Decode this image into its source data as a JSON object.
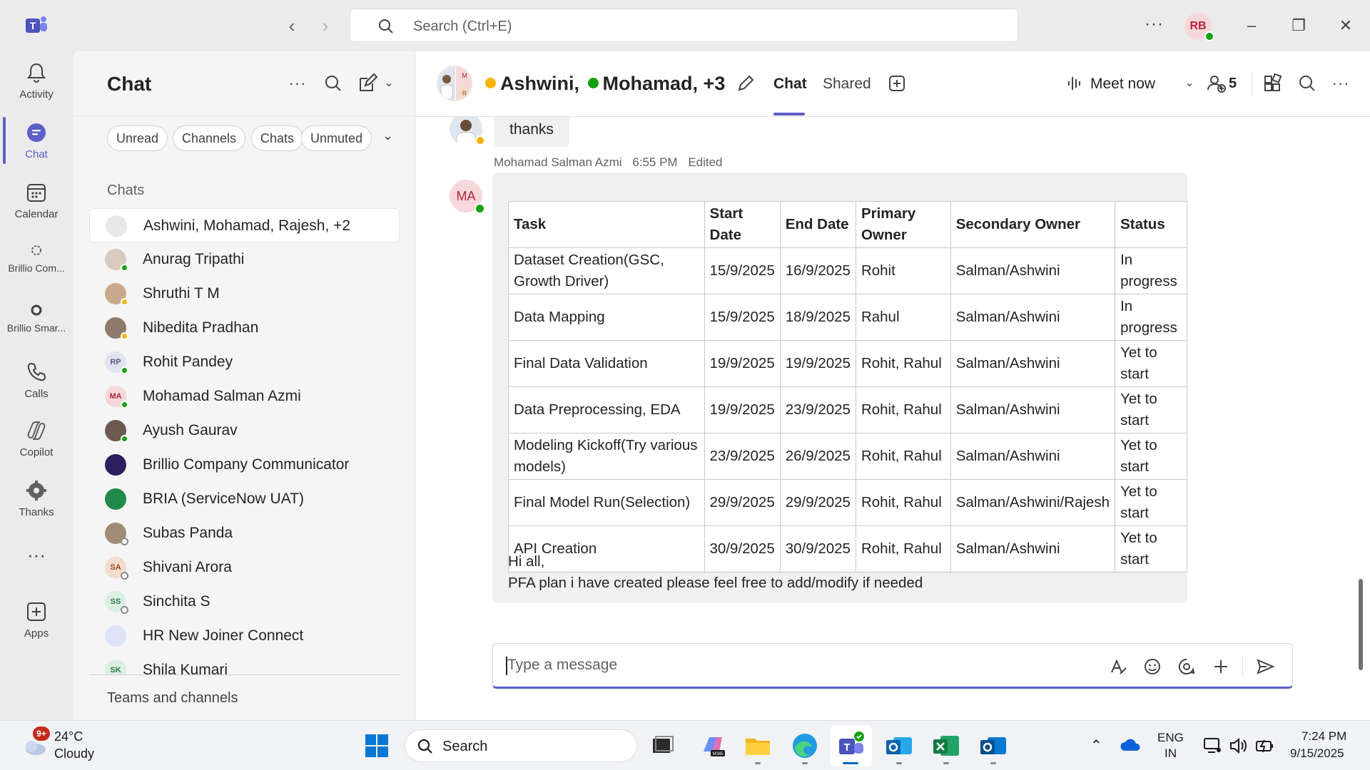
{
  "titlebar": {
    "search_placeholder": "Search (Ctrl+E)",
    "user_initials": "RB",
    "more": "···"
  },
  "rail": [
    {
      "label": "Activity",
      "icon": "bell-icon"
    },
    {
      "label": "Chat",
      "icon": "chat-icon",
      "active": true
    },
    {
      "label": "Calendar",
      "icon": "calendar-icon"
    },
    {
      "label": "Brillio Com...",
      "icon": "app-icon"
    },
    {
      "label": "Brillio Smar...",
      "icon": "app-icon"
    },
    {
      "label": "Calls",
      "icon": "phone-icon"
    },
    {
      "label": "Copilot",
      "icon": "copilot-icon"
    },
    {
      "label": "Thanks",
      "icon": "gear-icon"
    },
    {
      "label": "Apps",
      "icon": "add-app-icon"
    }
  ],
  "panel": {
    "title": "Chat",
    "filters": [
      "Unread",
      "Channels",
      "Chats",
      "Unmuted"
    ],
    "section": "Chats",
    "chats": [
      {
        "name": "Ashwini, Mohamad, Rajesh, +2",
        "initials": "",
        "bg": "#e8e8e8",
        "fg": "#424242"
      },
      {
        "name": "Anurag Tripathi",
        "initials": "",
        "bg": "#d9cbbd",
        "fg": "#424242"
      },
      {
        "name": "Shruthi T M",
        "initials": "",
        "bg": "#c9a98b",
        "fg": "#424242"
      },
      {
        "name": "Nibedita Pradhan",
        "initials": "",
        "bg": "#8f7b6c",
        "fg": "#424242"
      },
      {
        "name": "Rohit Pandey",
        "initials": "RP",
        "bg": "#e1e4ee",
        "fg": "#4f5b8a"
      },
      {
        "name": "Mohamad Salman Azmi",
        "initials": "MA",
        "bg": "#f6d7da",
        "fg": "#b5233b"
      },
      {
        "name": "Ayush Gaurav",
        "initials": "",
        "bg": "#6b5a4d",
        "fg": "#424242"
      },
      {
        "name": "Brillio Company Communicator",
        "initials": "",
        "bg": "#2d1f5e",
        "fg": "#ffffff"
      },
      {
        "name": "BRIA (ServiceNow UAT)",
        "initials": "",
        "bg": "#1f8a4c",
        "fg": "#ffffff"
      },
      {
        "name": "Subas Panda",
        "initials": "",
        "bg": "#a08b76",
        "fg": "#424242"
      },
      {
        "name": "Shivani Arora",
        "initials": "SA",
        "bg": "#f3dccf",
        "fg": "#9a4a22"
      },
      {
        "name": "Sinchita S",
        "initials": "SS",
        "bg": "#dcefe3",
        "fg": "#2a7a44"
      },
      {
        "name": "HR New Joiner Connect",
        "initials": "",
        "bg": "#dfe3f8",
        "fg": "#5b5fc7"
      },
      {
        "name": "Shila Kumari",
        "initials": "SK",
        "bg": "#dcefe3",
        "fg": "#2a7a44"
      }
    ],
    "teams_channels": "Teams and channels"
  },
  "conversation": {
    "title_names": [
      "Ashwini,",
      "Mohamad",
      ", +3"
    ],
    "tabs": [
      "Chat",
      "Shared"
    ],
    "meet_now": "Meet now",
    "participants": "5",
    "group_avatar_letters": [
      "M",
      "R"
    ]
  },
  "messages": {
    "thanks_text": "thanks",
    "author": "Mohamad Salman Azmi",
    "time": "6:55 PM",
    "edited": "Edited",
    "author_initials": "MA",
    "table_headers": [
      "Task",
      "Start Date",
      "End Date",
      "Primary Owner",
      "Secondary Owner",
      "Status"
    ],
    "table_rows": [
      [
        "Dataset Creation(GSC, Growth Driver)",
        "15/9/2025",
        "16/9/2025",
        "Rohit",
        "Salman/Ashwini",
        "In progress"
      ],
      [
        "Data Mapping",
        "15/9/2025",
        "18/9/2025",
        "Rahul",
        "Salman/Ashwini",
        "In progress"
      ],
      [
        "Final Data Validation",
        "19/9/2025",
        "19/9/2025",
        "Rohit, Rahul",
        "Salman/Ashwini",
        "Yet to start"
      ],
      [
        "Data Preprocessing, EDA",
        "19/9/2025",
        "23/9/2025",
        "Rohit, Rahul",
        "Salman/Ashwini",
        "Yet to start"
      ],
      [
        "Modeling Kickoff(Try various models)",
        "23/9/2025",
        "26/9/2025",
        "Rohit, Rahul",
        "Salman/Ashwini",
        "Yet to start"
      ],
      [
        "Final Model Run(Selection)",
        "29/9/2025",
        "29/9/2025",
        "Rohit, Rahul",
        "Salman/Ashwini/Rajesh",
        "Yet to start"
      ],
      [
        "API Creation",
        "30/9/2025",
        "30/9/2025",
        "Rohit, Rahul",
        "Salman/Ashwini",
        "Yet to start"
      ]
    ],
    "line1": "Hi all,",
    "line2": "PFA plan i have created please feel free to add/modify if needed"
  },
  "composer": {
    "placeholder": "Type a message"
  },
  "taskbar": {
    "weather_badge": "9+",
    "temperature": "24°C",
    "condition": "Cloudy",
    "search_placeholder": "Search",
    "lang": "ENG",
    "region": "IN",
    "time": "7:24 PM",
    "date": "9/15/2025"
  },
  "colors": {
    "accent": "#5b5fc7",
    "available": "#13a10e",
    "away": "#f8b400"
  }
}
